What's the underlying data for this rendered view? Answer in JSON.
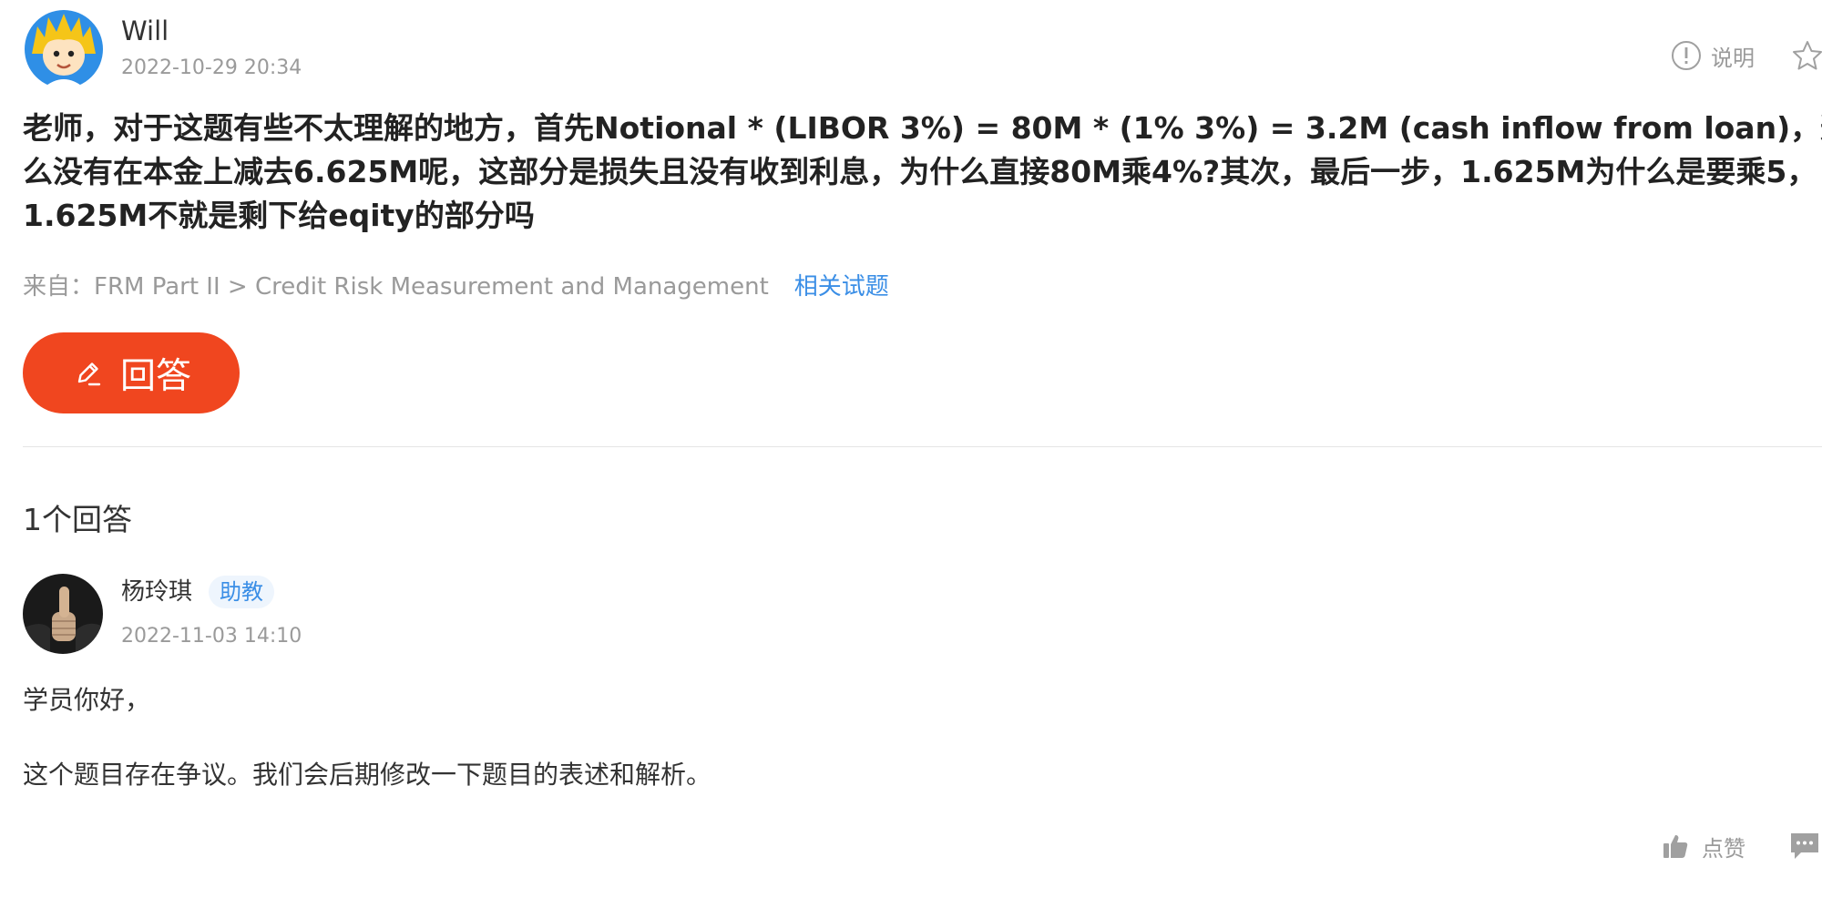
{
  "question": {
    "asker_name": "Will",
    "asker_time": "2022-10-29 20:34",
    "explain_label": "说明",
    "text_lines": [
      "老师，对于这题有些不太理解的地方，首先Notional * (LIBOR 3%) = 80M * (1% 3%) = 3.2M (cash inflow from loan)，这一步为什",
      "么没有在本金上减去6.625M呢，这部分是损失且没有收到利息，为什么直接80M乘4%?其次，最后一步，1.625M为什么是要乘5，",
      "1.625M不就是剩下给eqity的部分吗"
    ],
    "source_text": "来自：FRM Part II > Credit Risk Measurement and Management",
    "related_label": "相关试题",
    "answer_button_label": "回答"
  },
  "answers_section": {
    "count_label": "1个回答",
    "answers": [
      {
        "name": "杨玲琪",
        "role": "助教",
        "time": "2022-11-03 14:10",
        "paragraphs": [
          "学员你好，",
          "这个题目存在争议。我们会后期修改一下题目的表述和解析。"
        ],
        "like_label": "点赞"
      }
    ]
  },
  "colors": {
    "accent_button": "#f0461f",
    "link_blue": "#3a8ee6",
    "muted_text": "#9a9a9a",
    "divider": "#e5e5e5"
  }
}
